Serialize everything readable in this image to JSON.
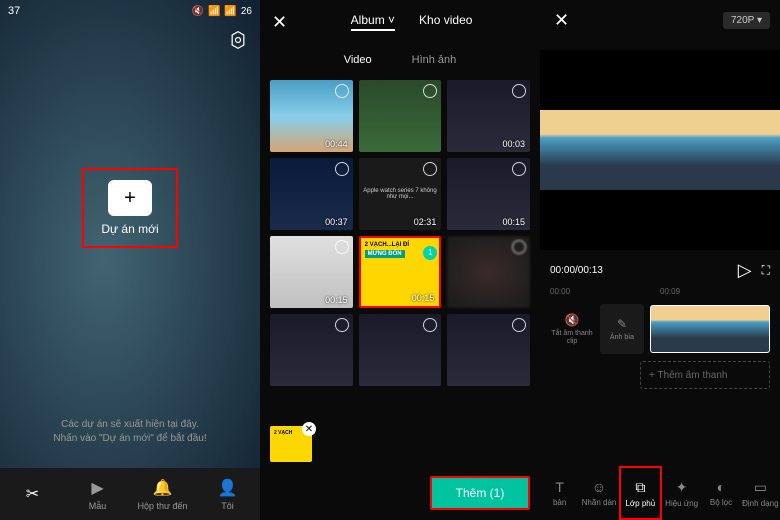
{
  "panel1": {
    "status_time": "37",
    "status_right": "26",
    "new_project": "Dự án mới",
    "hint_line1": "Các dự án sẽ xuất hiện tại đây.",
    "hint_line2": "Nhấn vào \"Dự án mới\" để bắt đầu!",
    "nav": [
      {
        "label": "",
        "icon": "cut"
      },
      {
        "label": "Mẫu",
        "icon": "template"
      },
      {
        "label": "Hộp thư đến",
        "icon": "bell"
      },
      {
        "label": "Tôi",
        "icon": "user"
      }
    ]
  },
  "panel2": {
    "tab_album": "Album",
    "tab_stock": "Kho video",
    "subtab_video": "Video",
    "subtab_image": "Hình ảnh",
    "thumbs": [
      {
        "dur": "00:44",
        "cls": "sky"
      },
      {
        "dur": "",
        "cls": "green"
      },
      {
        "dur": "00:03",
        "cls": "dark"
      },
      {
        "dur": "00:37",
        "cls": "night"
      },
      {
        "dur": "02:31",
        "cls": "text",
        "text": "Apple watch series 7 không như mọi..."
      },
      {
        "dur": "00:15",
        "cls": "dark"
      },
      {
        "dur": "00:15",
        "cls": "product"
      },
      {
        "dur": "00:15",
        "cls": "yellow",
        "highlighted": true,
        "yellow_text": "2 VẠCH...LẠI ĐÍ",
        "yellow_sub": "MỪNG ĐÓN",
        "badge": "1"
      },
      {
        "dur": "",
        "cls": "blur"
      },
      {
        "dur": "",
        "cls": "dark"
      },
      {
        "dur": "",
        "cls": "dark"
      },
      {
        "dur": "",
        "cls": "dark"
      }
    ],
    "add_label": "Thêm (1)"
  },
  "panel3": {
    "resolution": "720P",
    "time": "00:00/00:13",
    "ruler": [
      "00:00",
      "00:09"
    ],
    "mute_label": "Tắt âm thanh clip",
    "cover_label": "Ảnh bìa",
    "add_audio": "+ Thêm âm thanh",
    "nav": [
      {
        "label": "bản",
        "icon": "T"
      },
      {
        "label": "Nhãn dán",
        "icon": "sticker"
      },
      {
        "label": "Lớp phủ",
        "icon": "overlay",
        "highlighted": true
      },
      {
        "label": "Hiệu ứng",
        "icon": "effect"
      },
      {
        "label": "Bộ lọc",
        "icon": "filter"
      },
      {
        "label": "Định dạng",
        "icon": "format"
      }
    ]
  }
}
